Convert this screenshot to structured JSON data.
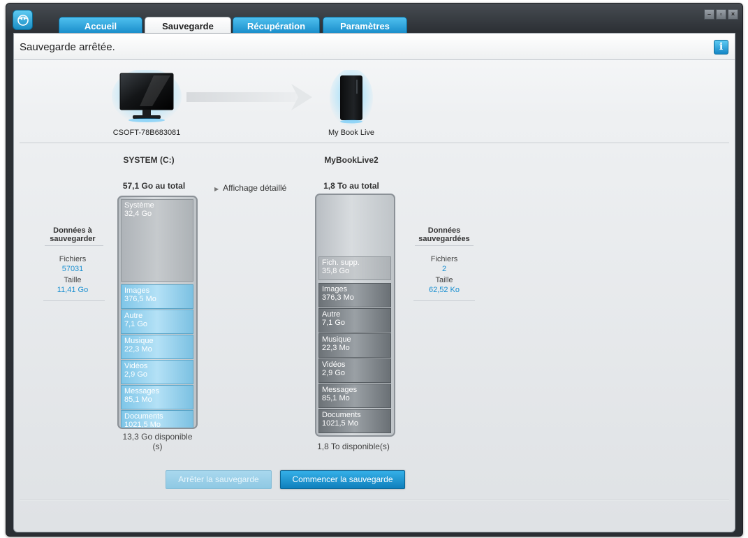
{
  "tabs": [
    {
      "label": "Accueil"
    },
    {
      "label": "Sauvegarde"
    },
    {
      "label": "Récupération"
    },
    {
      "label": "Paramètres"
    }
  ],
  "status": {
    "text": "Sauvegarde arrêtée."
  },
  "devices": {
    "source_name": "CSOFT-78B683081",
    "target_name": "My Book Live"
  },
  "source": {
    "volume": "SYSTEM (C:)",
    "total": "57,1 Go au total",
    "available": "13,3 Go disponible\n(s)",
    "segments": [
      {
        "name": "Système",
        "size": "32,4 Go"
      },
      {
        "name": "Images",
        "size": "376,5 Mo"
      },
      {
        "name": "Autre",
        "size": "7,1 Go"
      },
      {
        "name": "Musique",
        "size": "22,3 Mo"
      },
      {
        "name": "Vidéos",
        "size": "2,9 Go"
      },
      {
        "name": "Messages",
        "size": "85,1 Mo"
      },
      {
        "name": "Documents",
        "size": "1021,5 Mo"
      }
    ]
  },
  "target": {
    "volume": "MyBookLive2",
    "total": "1,8 To au total",
    "available": "1,8 To disponible(s)",
    "segments": [
      {
        "name": "Fich. supp.",
        "size": "35,8 Go"
      },
      {
        "name": "Images",
        "size": "376,3 Mo"
      },
      {
        "name": "Autre",
        "size": "7,1 Go"
      },
      {
        "name": "Musique",
        "size": "22,3 Mo"
      },
      {
        "name": "Vidéos",
        "size": "2,9 Go"
      },
      {
        "name": "Messages",
        "size": "85,1 Mo"
      },
      {
        "name": "Documents",
        "size": "1021,5 Mo"
      }
    ]
  },
  "detail_view": {
    "label": "Affichage détaillé"
  },
  "left_panel": {
    "title": "Données à sauvegarder",
    "files_label": "Fichiers",
    "files_value": "57031",
    "size_label": "Taille",
    "size_value": "11,41 Go"
  },
  "right_panel": {
    "title": "Données sauvegardées",
    "files_label": "Fichiers",
    "files_value": "2",
    "size_label": "Taille",
    "size_value": "62,52 Ko"
  },
  "buttons": {
    "stop": "Arrêter la sauvegarde",
    "start": "Commencer la sauvegarde"
  },
  "colors": {
    "accent": "#1a8fd0",
    "tab_blue": "#168ac8"
  },
  "icons": {
    "logo": "wd-logo-icon",
    "info": "info-icon",
    "arrow": "arrow-right-icon"
  }
}
